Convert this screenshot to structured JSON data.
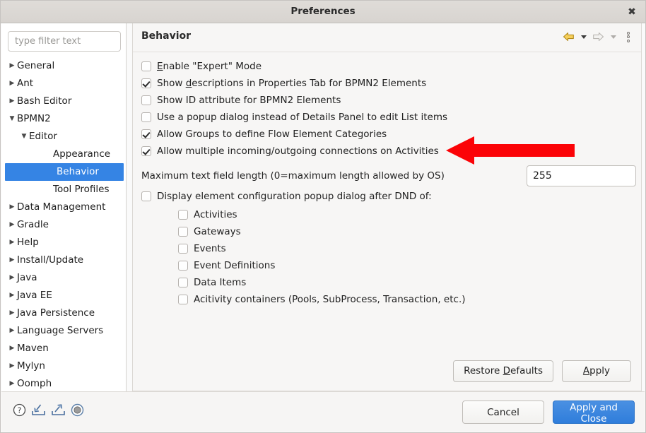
{
  "window": {
    "title": "Preferences",
    "close_icon": "close-icon"
  },
  "sidebar": {
    "filter_placeholder": "type filter text",
    "filter_value": "",
    "items": [
      {
        "label": "General",
        "level": 0,
        "twisty": "collapsed",
        "selected": false
      },
      {
        "label": "Ant",
        "level": 0,
        "twisty": "collapsed",
        "selected": false
      },
      {
        "label": "Bash Editor",
        "level": 0,
        "twisty": "collapsed",
        "selected": false
      },
      {
        "label": "BPMN2",
        "level": 0,
        "twisty": "expanded",
        "selected": false
      },
      {
        "label": "Editor",
        "level": 1,
        "twisty": "expanded",
        "selected": false
      },
      {
        "label": "Appearance",
        "level": 2,
        "twisty": "none",
        "selected": false
      },
      {
        "label": "Behavior",
        "level": 2,
        "twisty": "none",
        "selected": true
      },
      {
        "label": "Tool Profiles",
        "level": 2,
        "twisty": "none",
        "selected": false
      },
      {
        "label": "Data Management",
        "level": 0,
        "twisty": "collapsed",
        "selected": false
      },
      {
        "label": "Gradle",
        "level": 0,
        "twisty": "collapsed",
        "selected": false
      },
      {
        "label": "Help",
        "level": 0,
        "twisty": "collapsed",
        "selected": false
      },
      {
        "label": "Install/Update",
        "level": 0,
        "twisty": "collapsed",
        "selected": false
      },
      {
        "label": "Java",
        "level": 0,
        "twisty": "collapsed",
        "selected": false
      },
      {
        "label": "Java EE",
        "level": 0,
        "twisty": "collapsed",
        "selected": false
      },
      {
        "label": "Java Persistence",
        "level": 0,
        "twisty": "collapsed",
        "selected": false
      },
      {
        "label": "Language Servers",
        "level": 0,
        "twisty": "collapsed",
        "selected": false
      },
      {
        "label": "Maven",
        "level": 0,
        "twisty": "collapsed",
        "selected": false
      },
      {
        "label": "Mylyn",
        "level": 0,
        "twisty": "collapsed",
        "selected": false
      },
      {
        "label": "Oomph",
        "level": 0,
        "twisty": "collapsed",
        "selected": false
      }
    ]
  },
  "content": {
    "title": "Behavior",
    "toolbar": {
      "back_icon": "back-arrow-icon",
      "back_dropdown_icon": "chevron-down-icon",
      "forward_icon": "forward-arrow-icon",
      "forward_dropdown_icon": "chevron-down-icon",
      "menu_icon": "vertical-dots-menu-icon"
    },
    "checkboxes": [
      {
        "label": "Enable \"Expert\" Mode",
        "checked": false,
        "mnemonic": "E"
      },
      {
        "label": "Show descriptions in Properties Tab for BPMN2 Elements",
        "checked": true,
        "mnemonic": "d"
      },
      {
        "label": "Show ID attribute for BPMN2 Elements",
        "checked": false,
        "mnemonic": ""
      },
      {
        "label": "Use a popup dialog instead of Details Panel to edit List items",
        "checked": false,
        "mnemonic": ""
      },
      {
        "label": "Allow Groups to define Flow Element Categories",
        "checked": true,
        "mnemonic": ""
      },
      {
        "label": "Allow multiple incoming/outgoing connections on Activities",
        "checked": true,
        "mnemonic": ""
      }
    ],
    "max_text_field": {
      "label": "Maximum text field length (0=maximum length allowed by OS)",
      "value": "255"
    },
    "dnd": {
      "label": "Display element configuration popup dialog after DND of:",
      "checked": false,
      "items": [
        {
          "label": "Activities",
          "checked": false
        },
        {
          "label": "Gateways",
          "checked": false
        },
        {
          "label": "Events",
          "checked": false
        },
        {
          "label": "Event Definitions",
          "checked": false
        },
        {
          "label": "Data Items",
          "checked": false
        },
        {
          "label": "Acitivity containers (Pools, SubProcess, Transaction, etc.)",
          "checked": false
        }
      ]
    },
    "actions": {
      "restore_defaults": "Restore Defaults",
      "restore_defaults_mnemonic": "D",
      "apply": "Apply",
      "apply_mnemonic": "A"
    }
  },
  "footer": {
    "icons": [
      {
        "name": "help-icon"
      },
      {
        "name": "import-icon"
      },
      {
        "name": "export-icon"
      },
      {
        "name": "oomph-recorder-icon"
      }
    ],
    "cancel": "Cancel",
    "apply_and_close": "Apply and Close"
  },
  "annotation": {
    "arrow_icon": "red-left-arrow-annotation",
    "color": "#fb0307"
  },
  "colors": {
    "selection_blue": "#3584e4",
    "primary_button": "#3a83dd",
    "annotation_red": "#fb0307",
    "titlebar": "#dcd9d5"
  }
}
